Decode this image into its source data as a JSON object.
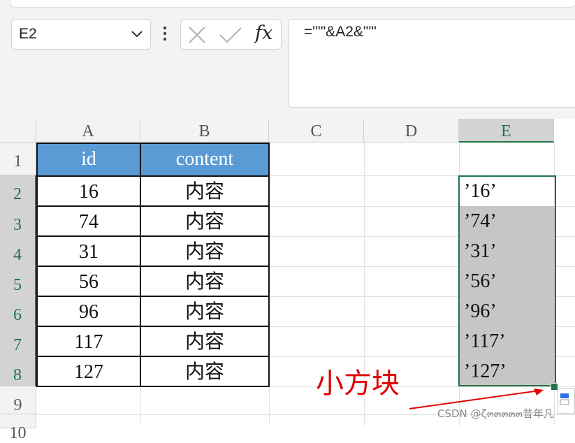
{
  "name_box": {
    "value": "E2"
  },
  "formula_bar": {
    "fx_label": "fx",
    "formula": "=\"'\"&A2&\"'\""
  },
  "columns": [
    "A",
    "B",
    "C",
    "D",
    "E"
  ],
  "rows": [
    "1",
    "2",
    "3",
    "4",
    "5",
    "6",
    "7",
    "8",
    "9",
    "10"
  ],
  "table": {
    "headers": [
      "id",
      "content"
    ],
    "rows": [
      [
        "16",
        "内容"
      ],
      [
        "74",
        "内容"
      ],
      [
        "31",
        "内容"
      ],
      [
        "56",
        "内容"
      ],
      [
        "96",
        "内容"
      ],
      [
        "117",
        "内容"
      ],
      [
        "127",
        "内容"
      ]
    ]
  },
  "column_e": [
    "’16’",
    "’74’",
    "’31’",
    "’56’",
    "’96’",
    "’117’",
    "’127’"
  ],
  "annotation": "小方块",
  "watermark": "CSDN @ζ๓๓๓๓๓昔年凡",
  "colors": {
    "accent": "#217346",
    "header_fill": "#5b9bd5",
    "annotation": "#e00000"
  }
}
